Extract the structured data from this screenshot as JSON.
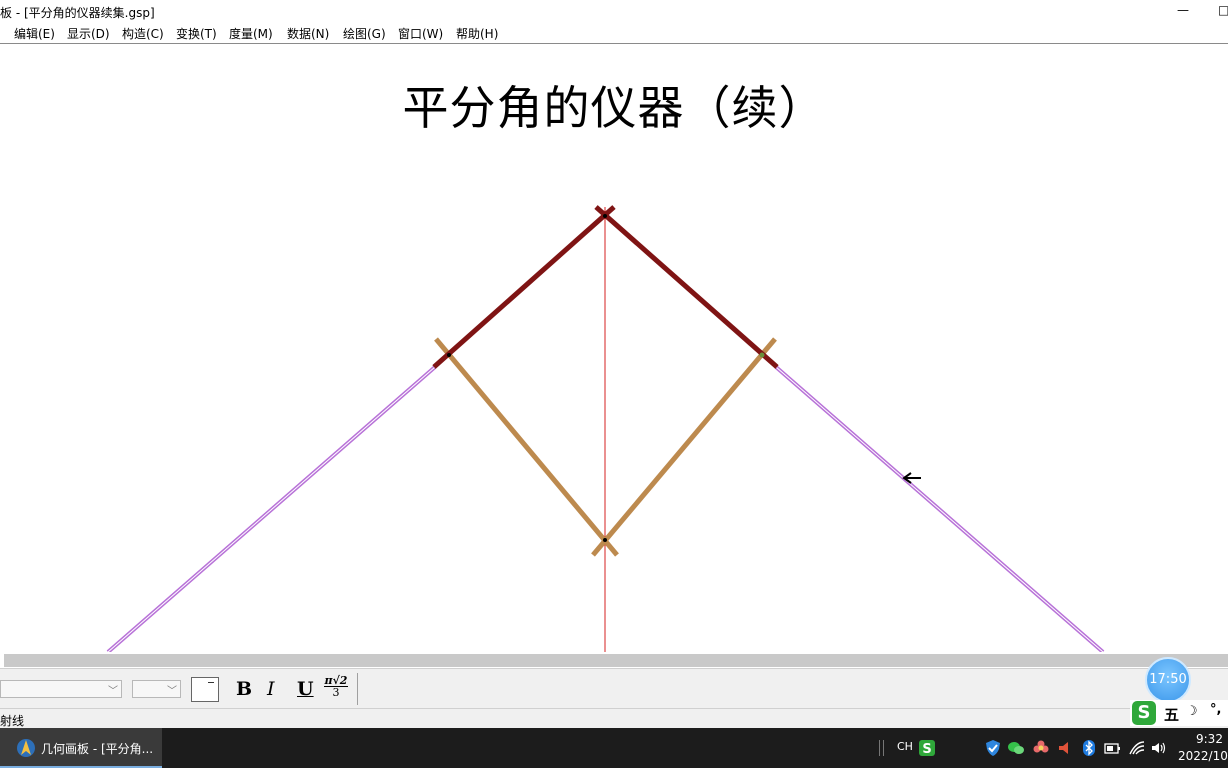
{
  "window": {
    "title": "板 - [平分角的仪器续集.gsp]",
    "minimize_glyph": "—",
    "restore_glyph": "□"
  },
  "menu": [
    {
      "label": "编辑(E)"
    },
    {
      "label": "显示(D)"
    },
    {
      "label": "构造(C)"
    },
    {
      "label": "变换(T)"
    },
    {
      "label": "度量(M)"
    },
    {
      "label": "数据(N)"
    },
    {
      "label": "绘图(G)"
    },
    {
      "label": "窗口(W)"
    },
    {
      "label": "帮助(H)"
    }
  ],
  "document": {
    "title": "平分角的仪器（续）"
  },
  "colors": {
    "dark_red_arms": "#7f1414",
    "tan_arms": "#bd8a4e",
    "purple_rays": "#b872d8",
    "bisector": "#d42020"
  },
  "text_toolbar": {
    "bold": "B",
    "italic": "I",
    "underline": "U",
    "math_numerator": "π√2",
    "math_denominator": "3"
  },
  "status": {
    "text": "射线"
  },
  "taskbar": {
    "app_label": "几何画板 - [平分角...",
    "ime_lang": "CH",
    "time": "9:32",
    "date": "2022/10,"
  },
  "ime": {
    "s_glyph": "S",
    "mode": "五",
    "moon": "☽",
    "punct": "°,"
  },
  "timer": {
    "label": "17:50"
  }
}
